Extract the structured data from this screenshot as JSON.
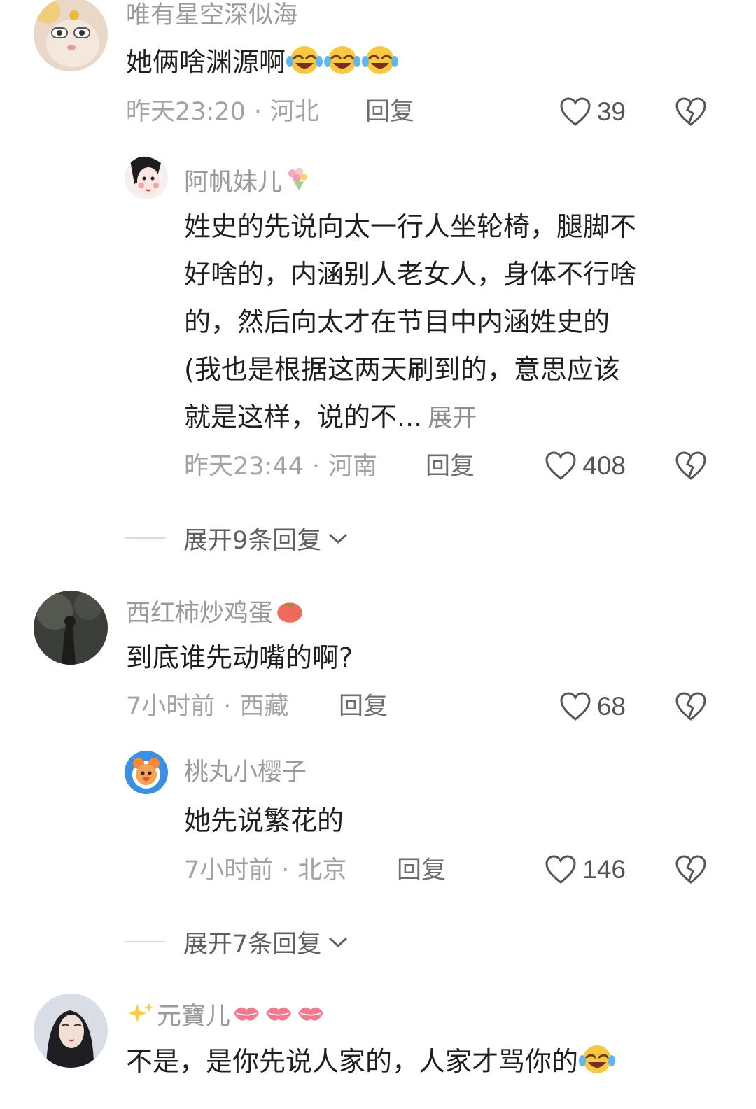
{
  "comments": [
    {
      "username": "唯有星空深似海",
      "text": "她俩啥渊源啊",
      "emoji": [
        "crying-laugh-emoji",
        "crying-laugh-emoji",
        "crying-laugh-emoji"
      ],
      "time": "昨天23:20",
      "location": "河北",
      "reply_label": "回复",
      "likes": "39",
      "replies": [
        {
          "username": "阿帆妹儿",
          "username_deco": "bouquet-emoji",
          "lines": [
            "姓史的先说向太一行人坐轮椅，腿脚不",
            "好啥的，内涵别人老女人，身体不行啥",
            "的，然后向太才在节目中内涵姓史的",
            "(我也是根据这两天刷到的，意思应该",
            "就是这样，说的不..."
          ],
          "expand_label": "展开",
          "time": "昨天23:44",
          "location": "河南",
          "reply_label": "回复",
          "likes": "408"
        }
      ],
      "more_replies_label": "展开9条回复"
    },
    {
      "username": "西红柿炒鸡蛋",
      "username_deco": "tomato-emoji",
      "text": "到底谁先动嘴的啊?",
      "time": "7小时前",
      "location": "西藏",
      "reply_label": "回复",
      "likes": "68",
      "replies": [
        {
          "username": "桃丸小樱子",
          "text": "她先说繁花的",
          "time": "7小时前",
          "location": "北京",
          "reply_label": "回复",
          "likes": "146"
        }
      ],
      "more_replies_label": "展开7条回复"
    },
    {
      "username": "元寶儿",
      "username_prefix": "sparkles-emoji",
      "username_deco": [
        "kiss-mark-emoji",
        "kiss-mark-emoji",
        "kiss-mark-emoji"
      ],
      "text": "不是，是你先说人家的，人家才骂你的",
      "emoji": [
        "crying-laugh-emoji"
      ]
    }
  ],
  "dot": "·",
  "colors": {
    "username": "#9a9a9a",
    "body": "#1f1f1f",
    "meta": "#a3a3a3",
    "reply": "#6e6e6e",
    "icon": "#555555"
  }
}
